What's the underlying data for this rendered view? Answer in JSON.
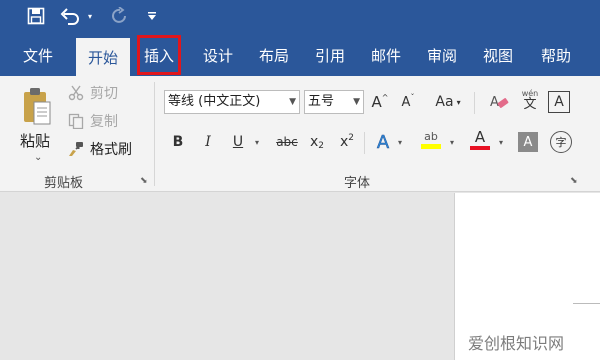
{
  "quick_access": {
    "save": "save-icon",
    "undo": "undo-icon",
    "redo": "redo-icon",
    "customize": "customize-icon"
  },
  "tabs": [
    {
      "label": "文件",
      "active": false
    },
    {
      "label": "开始",
      "active": true
    },
    {
      "label": "插入",
      "active": false,
      "highlighted": true
    },
    {
      "label": "设计",
      "active": false
    },
    {
      "label": "布局",
      "active": false
    },
    {
      "label": "引用",
      "active": false
    },
    {
      "label": "邮件",
      "active": false
    },
    {
      "label": "审阅",
      "active": false
    },
    {
      "label": "视图",
      "active": false
    },
    {
      "label": "帮助",
      "active": false
    }
  ],
  "clipboard": {
    "group_label": "剪贴板",
    "paste_label": "粘贴",
    "cut_label": "剪切",
    "copy_label": "复制",
    "format_painter_label": "格式刷"
  },
  "font": {
    "group_label": "字体",
    "font_name": "等线 (中文正文)",
    "font_size": "五号",
    "grow_glyph": "A",
    "shrink_glyph": "A",
    "case_glyph": "Aa",
    "phonetic_glyph": "wén",
    "phonetic_char": "文",
    "border_glyph": "A",
    "bold": "B",
    "italic": "I",
    "underline": "U",
    "strike": "abc",
    "subscript": "x",
    "superscript": "x",
    "sub_mark": "2",
    "sup_mark": "2",
    "effects_glyph": "A",
    "highlight_glyph": "ab",
    "color_glyph": "A",
    "shading_glyph": "A",
    "enclose_glyph": "字"
  },
  "colors": {
    "accent": "#2b579a",
    "highlight_outline": "#e0161c",
    "highlight_yellow": "#ffff00",
    "font_color_red": "#e81123"
  },
  "watermark": "爱创根知识网"
}
